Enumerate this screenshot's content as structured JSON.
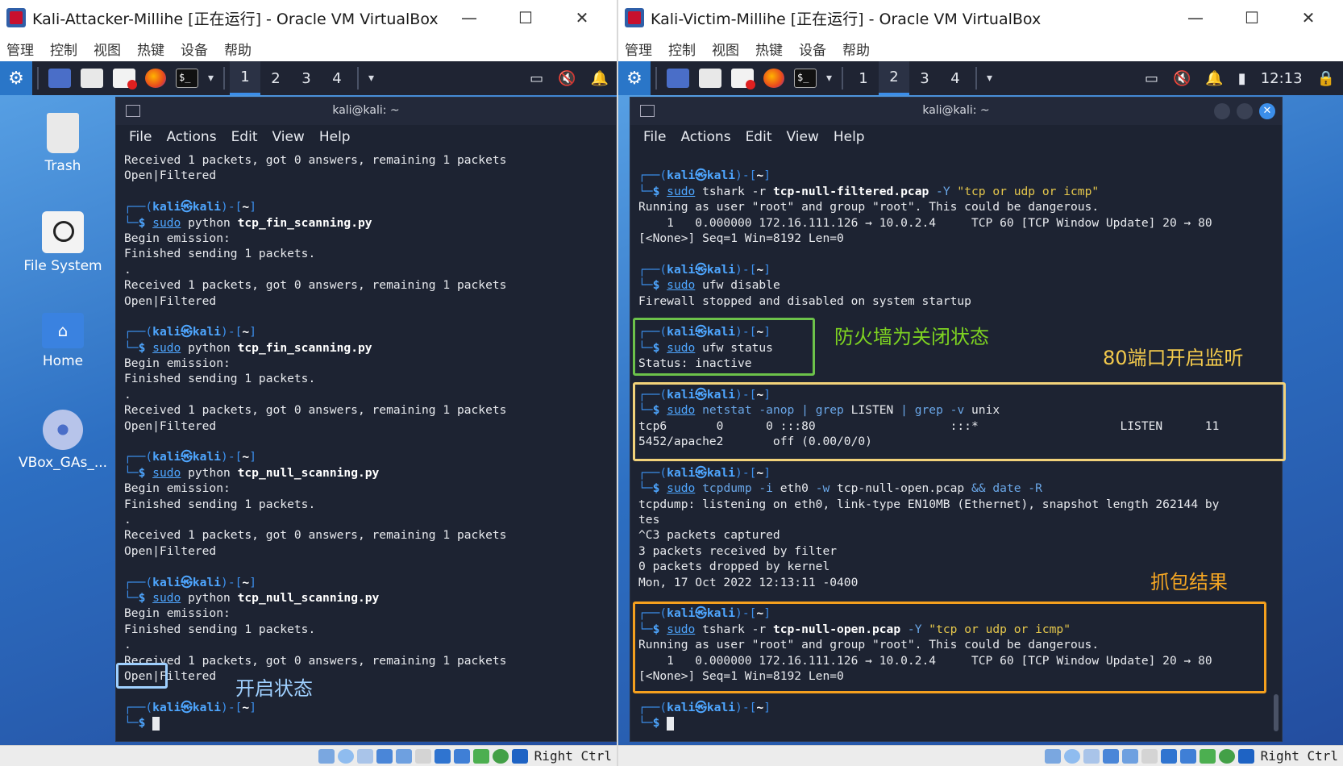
{
  "left_window": {
    "title": "Kali-Attacker-Millihe [正在运行] - Oracle VM VirtualBox",
    "menu": [
      "管理",
      "控制",
      "视图",
      "热键",
      "设备",
      "帮助"
    ],
    "workspaces": [
      "1",
      "2",
      "3",
      "4"
    ],
    "active_workspace": "1",
    "desktop_icons": [
      {
        "label": "Trash",
        "icon": "trash-icon"
      },
      {
        "label": "File System",
        "icon": "drive-icon"
      },
      {
        "label": "Home",
        "icon": "home-folder-icon"
      },
      {
        "label": "VBox_GAs_...",
        "icon": "disc-icon"
      }
    ],
    "terminal": {
      "title": "kali@kali: ~",
      "menu": [
        "File",
        "Actions",
        "Edit",
        "View",
        "Help"
      ],
      "prompt": {
        "user": "kali",
        "at": "㉿",
        "host": "kali",
        "dir": "~"
      },
      "lines": [
        {
          "type": "out",
          "text": "Received 1 packets, got 0 answers, remaining 1 packets"
        },
        {
          "type": "out",
          "text": "Open|Filtered"
        },
        {
          "type": "blank"
        },
        {
          "type": "prompt"
        },
        {
          "type": "cmd",
          "cmd": "sudo",
          "args": " python ",
          "file": "tcp_fin_scanning.py"
        },
        {
          "type": "out",
          "text": "Begin emission:"
        },
        {
          "type": "out",
          "text": "Finished sending 1 packets."
        },
        {
          "type": "out",
          "text": "."
        },
        {
          "type": "out",
          "text": "Received 1 packets, got 0 answers, remaining 1 packets"
        },
        {
          "type": "out",
          "text": "Open|Filtered"
        },
        {
          "type": "blank"
        },
        {
          "type": "prompt"
        },
        {
          "type": "cmd",
          "cmd": "sudo",
          "args": " python ",
          "file": "tcp_fin_scanning.py"
        },
        {
          "type": "out",
          "text": "Begin emission:"
        },
        {
          "type": "out",
          "text": "Finished sending 1 packets."
        },
        {
          "type": "out",
          "text": "."
        },
        {
          "type": "out",
          "text": "Received 1 packets, got 0 answers, remaining 1 packets"
        },
        {
          "type": "out",
          "text": "Open|Filtered"
        },
        {
          "type": "blank"
        },
        {
          "type": "prompt"
        },
        {
          "type": "cmd",
          "cmd": "sudo",
          "args": " python ",
          "file": "tcp_null_scanning.py"
        },
        {
          "type": "out",
          "text": "Begin emission:"
        },
        {
          "type": "out",
          "text": "Finished sending 1 packets."
        },
        {
          "type": "out",
          "text": "."
        },
        {
          "type": "out",
          "text": "Received 1 packets, got 0 answers, remaining 1 packets"
        },
        {
          "type": "out",
          "text": "Open|Filtered"
        },
        {
          "type": "blank"
        },
        {
          "type": "prompt"
        },
        {
          "type": "cmd",
          "cmd": "sudo",
          "args": " python ",
          "file": "tcp_null_scanning.py"
        },
        {
          "type": "out",
          "text": "Begin emission:"
        },
        {
          "type": "out",
          "text": "Finished sending 1 packets."
        },
        {
          "type": "out",
          "text": "."
        },
        {
          "type": "out",
          "text": "Received 1 packets, got 0 answers, remaining 1 packets"
        },
        {
          "type": "out",
          "text": "Open|Filtered"
        },
        {
          "type": "blank"
        },
        {
          "type": "prompt"
        },
        {
          "type": "cursor"
        }
      ]
    },
    "annotation": {
      "text": "开启状态",
      "color": "#9fd0ff",
      "box_color": "#9fd0ff"
    },
    "status_bar": {
      "host_key": "Right Ctrl"
    }
  },
  "right_window": {
    "title": "Kali-Victim-Millihe [正在运行] - Oracle VM VirtualBox",
    "menu": [
      "管理",
      "控制",
      "视图",
      "热键",
      "设备",
      "帮助"
    ],
    "workspaces": [
      "1",
      "2",
      "3",
      "4"
    ],
    "active_workspace": "2",
    "clock": "12:13",
    "terminal": {
      "title": "kali@kali: ~",
      "menu": [
        "File",
        "Actions",
        "Edit",
        "View",
        "Help"
      ],
      "prompt": {
        "user": "kali",
        "at": "㉿",
        "host": "kali",
        "dir": "~"
      },
      "lines": [
        {
          "type": "blank"
        },
        {
          "type": "prompt"
        },
        {
          "type": "cmd",
          "cmd": "sudo",
          "args": " tshark -r ",
          "file": "tcp-null-filtered.pcap",
          "rest_opt": " -Y ",
          "rest_str": "\"tcp or udp or icmp\""
        },
        {
          "type": "out",
          "text": "Running as user \"root\" and group \"root\". This could be dangerous."
        },
        {
          "type": "out",
          "text": "    1   0.000000 172.16.111.126 → 10.0.2.4     TCP 60 [TCP Window Update] 20 → 80"
        },
        {
          "type": "out",
          "text": "[<None>] Seq=1 Win=8192 Len=0"
        },
        {
          "type": "blank"
        },
        {
          "type": "prompt"
        },
        {
          "type": "cmd",
          "cmd": "sudo",
          "args": " ufw disable",
          "file": ""
        },
        {
          "type": "out",
          "text": "Firewall stopped and disabled on system startup"
        },
        {
          "type": "blank"
        },
        {
          "type": "prompt"
        },
        {
          "type": "cmd",
          "cmd": "sudo",
          "args": " ufw status",
          "file": ""
        },
        {
          "type": "out",
          "text": "Status: inactive"
        },
        {
          "type": "blank"
        },
        {
          "type": "prompt"
        },
        {
          "type": "netstat",
          "cmd": "sudo",
          "a1": " netstat ",
          "o1": "-anop",
          "p1": " | ",
          "c2": "grep",
          "a2": " LISTEN ",
          "p2": "| ",
          "c3": "grep",
          "o3": " -v",
          "a3": " unix"
        },
        {
          "type": "out",
          "text": "tcp6       0      0 :::80                   :::*                    LISTEN      11"
        },
        {
          "type": "out",
          "text": "5452/apache2       off (0.00/0/0)"
        },
        {
          "type": "blank"
        },
        {
          "type": "prompt"
        },
        {
          "type": "tcpdump",
          "cmd": "sudo",
          "c1": " tcpdump",
          "o1": " -i",
          "a1": " eth0 ",
          "o2": "-w",
          "a2": " tcp-null-open.pcap ",
          "amp": "&&",
          "c2": " date",
          "o3": " -R"
        },
        {
          "type": "out",
          "text": "tcpdump: listening on eth0, link-type EN10MB (Ethernet), snapshot length 262144 by"
        },
        {
          "type": "out",
          "text": "tes"
        },
        {
          "type": "out",
          "text": "^C3 packets captured"
        },
        {
          "type": "out",
          "text": "3 packets received by filter"
        },
        {
          "type": "out",
          "text": "0 packets dropped by kernel"
        },
        {
          "type": "out",
          "text": "Mon, 17 Oct 2022 12:13:11 -0400"
        },
        {
          "type": "blank"
        },
        {
          "type": "prompt"
        },
        {
          "type": "cmd",
          "cmd": "sudo",
          "args": " tshark -r ",
          "file": "tcp-null-open.pcap",
          "rest_opt": " -Y ",
          "rest_str": "\"tcp or udp or icmp\""
        },
        {
          "type": "out",
          "text": "Running as user \"root\" and group \"root\". This could be dangerous."
        },
        {
          "type": "out",
          "text": "    1   0.000000 172.16.111.126 → 10.0.2.4     TCP 60 [TCP Window Update] 20 → 80"
        },
        {
          "type": "out",
          "text": "[<None>] Seq=1 Win=8192 Len=0"
        },
        {
          "type": "blank"
        },
        {
          "type": "prompt"
        },
        {
          "type": "cursor"
        }
      ]
    },
    "annotations": [
      {
        "text": "防火墙为关闭状态",
        "color": "#7ed321"
      },
      {
        "text": "80端口开启监听",
        "color": "#f2c94c"
      },
      {
        "text": "抓包结果",
        "color": "#f5a623"
      }
    ],
    "status_bar": {
      "host_key": "Right Ctrl"
    }
  }
}
